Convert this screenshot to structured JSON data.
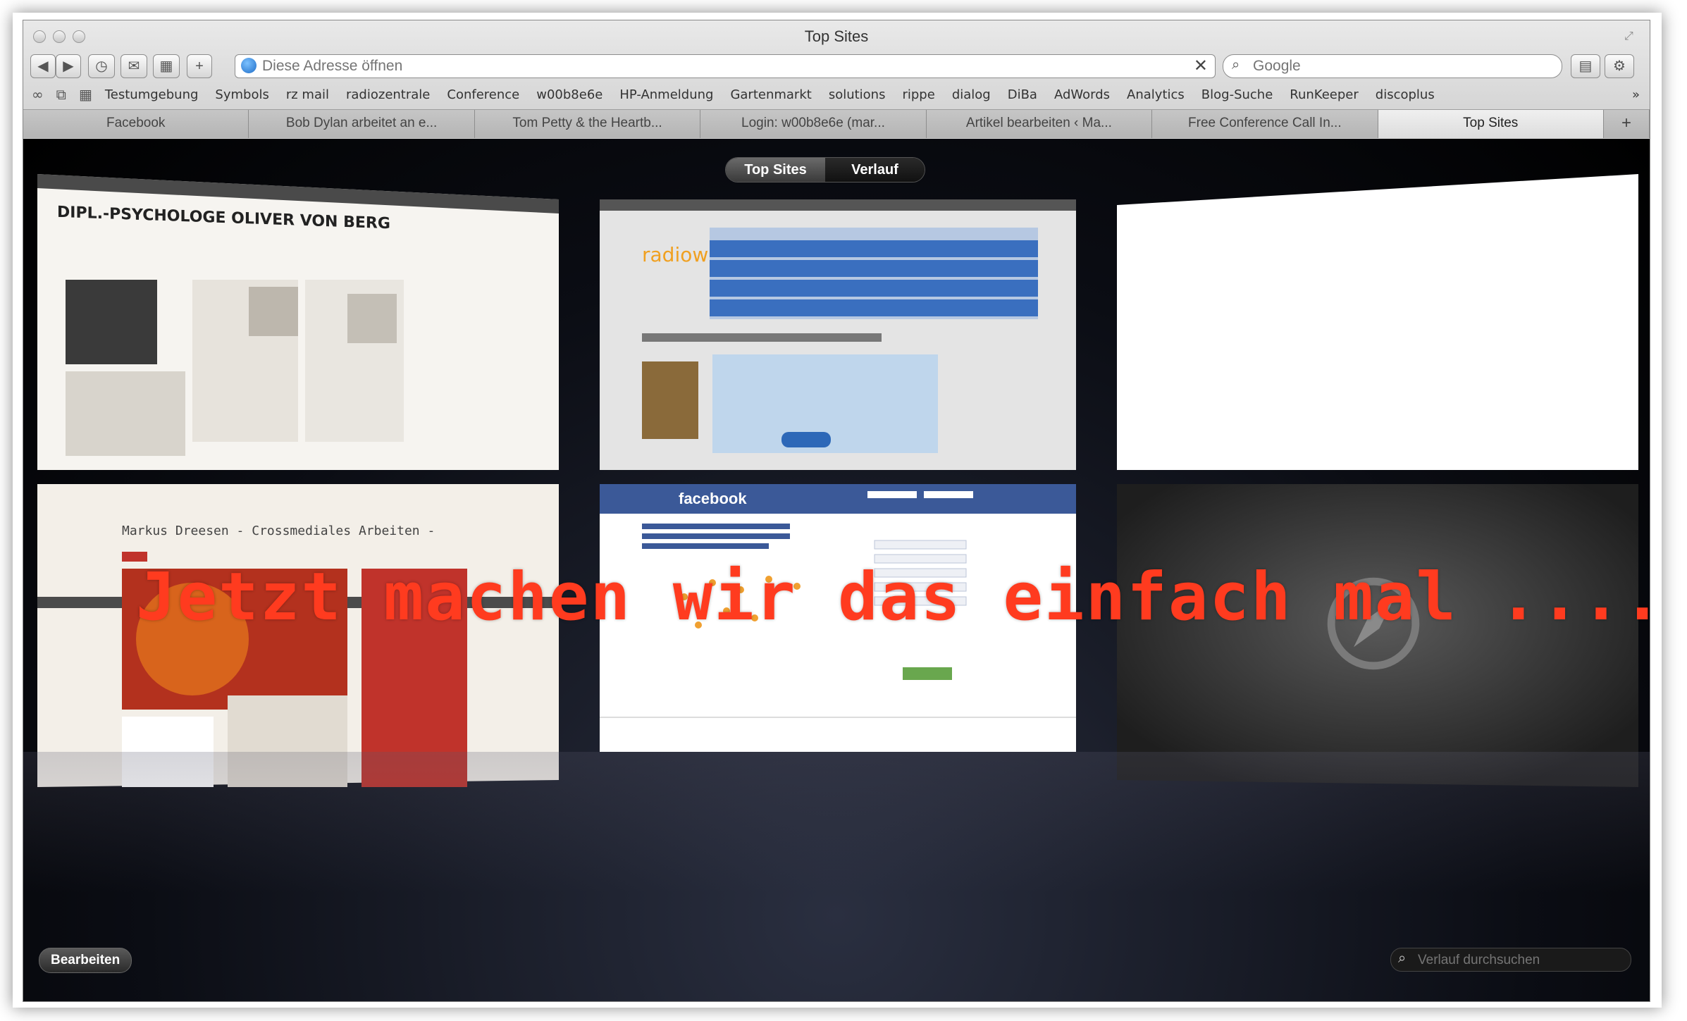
{
  "window": {
    "title": "Top Sites"
  },
  "toolbar": {
    "url_placeholder": "Diese Adresse öffnen",
    "search_placeholder": "Google",
    "plus_label": "+"
  },
  "bookmarks": [
    "Testumgebung",
    "Symbols",
    "rz mail",
    "radiozentrale",
    "Conference",
    "w00b8e6e",
    "HP-Anmeldung",
    "Gartenmarkt",
    "solutions",
    "rippe",
    "dialog",
    "DiBa",
    "AdWords",
    "Analytics",
    "Blog-Suche",
    "RunKeeper",
    "discoplus"
  ],
  "tabs": [
    "Facebook",
    "Bob Dylan arbeitet an e...",
    "Tom Petty & the Heartb...",
    "Login: w00b8e6e (mar...",
    "Artikel bearbeiten ‹ Ma...",
    "Free Conference Call In...",
    "Top Sites"
  ],
  "segmented": {
    "top_sites": "Top Sites",
    "history": "Verlauf"
  },
  "tiles": [
    {
      "name": "tile-psychologe",
      "heading": "DIPL.-PSYCHOLOGE OLIVER VON BERG"
    },
    {
      "name": "tile-radio",
      "heading": "radiow"
    },
    {
      "name": "tile-blank",
      "heading": ""
    },
    {
      "name": "tile-dreesen",
      "heading": "Markus Dreesen - Crossmediales Arbeiten -"
    },
    {
      "name": "tile-facebook",
      "heading": "facebook"
    },
    {
      "name": "tile-safari",
      "heading": ""
    }
  ],
  "overlay_caption": "Jetzt machen wir das einfach mal ....",
  "bottom": {
    "edit_label": "Bearbeiten",
    "history_placeholder": "Verlauf durchsuchen"
  },
  "colors": {
    "caption": "#ff3b1f",
    "facebook": "#3b5998"
  }
}
